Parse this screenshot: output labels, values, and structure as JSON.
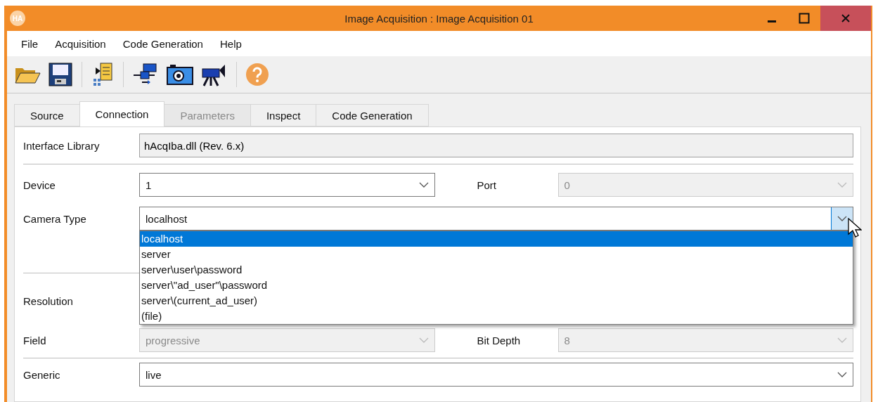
{
  "window": {
    "logo": "HA",
    "title": "Image Acquisition : Image Acquisition 01"
  },
  "menu": [
    "File",
    "Acquisition",
    "Code Generation",
    "Help"
  ],
  "tabs": [
    {
      "label": "Source",
      "selected": false,
      "disabled": false
    },
    {
      "label": "Connection",
      "selected": true,
      "disabled": false
    },
    {
      "label": "Parameters",
      "selected": false,
      "disabled": true
    },
    {
      "label": "Inspect",
      "selected": false,
      "disabled": false
    },
    {
      "label": "Code Generation",
      "selected": false,
      "disabled": false
    }
  ],
  "interface_library": {
    "label": "Interface Library",
    "value": "hAcqIba.dll (Rev. 6.x)"
  },
  "device": {
    "label": "Device",
    "value": "1",
    "disabled": false
  },
  "port": {
    "label": "Port",
    "value": "0",
    "disabled": true
  },
  "camera_type": {
    "label": "Camera Type",
    "value": "localhost",
    "expanded": true,
    "options": [
      {
        "label": "localhost",
        "selected": true
      },
      {
        "label": "server",
        "selected": false
      },
      {
        "label": "server\\user\\password",
        "selected": false
      },
      {
        "label": "server\\\"ad_user\"\\password",
        "selected": false
      },
      {
        "label": "server\\(current_ad_user)",
        "selected": false
      },
      {
        "label": "(file)",
        "selected": false
      }
    ]
  },
  "resolution": {
    "label": "Resolution"
  },
  "field": {
    "label": "Field",
    "value": "progressive",
    "disabled": true
  },
  "bit_depth": {
    "label": "Bit Depth",
    "value": "8",
    "disabled": true
  },
  "generic": {
    "label": "Generic",
    "value": "live",
    "disabled": false
  }
}
